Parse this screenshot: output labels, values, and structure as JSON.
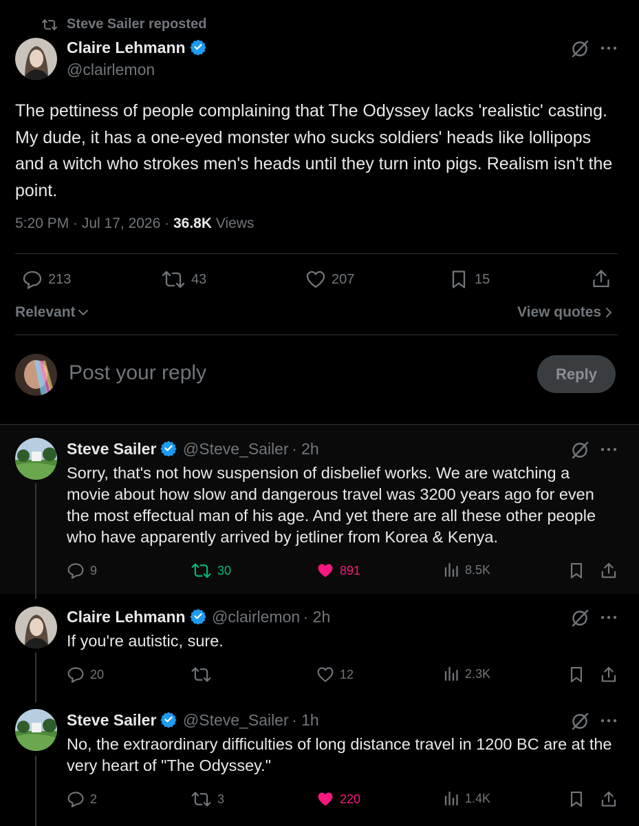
{
  "repost_banner": {
    "text": "Steve Sailer reposted"
  },
  "main_post": {
    "author_name": "Claire Lehmann",
    "author_handle": "@clairlemon",
    "text": "The pettiness of people complaining that The Odyssey lacks 'realistic' casting. My dude, it has a one-eyed monster who sucks soldiers' heads like lollipops and a witch who strokes men's heads until they turn into pigs. Realism isn't the point.",
    "time": "5:20 PM · Jul 17, 2026 · ",
    "views_count": "36.8K",
    "views_label": " Views",
    "stats": {
      "replies": "213",
      "reposts": "43",
      "likes": "207",
      "bookmarks": "15"
    }
  },
  "sort": {
    "label": "Relevant",
    "view_quotes": "View quotes"
  },
  "composer": {
    "placeholder": "Post your reply",
    "button": "Reply"
  },
  "replies": [
    {
      "author_name": "Steve Sailer",
      "author_handle": "@Steve_Sailer",
      "time": "· 2h",
      "text": "Sorry, that's not how suspension of disbelief works. We are watching a movie about how slow and dangerous travel was 3200 years ago for even the most effectual man of his age. And yet there are all these other people who have apparently arrived by jetliner from Korea & Kenya.",
      "replies": "9",
      "reposts": "30",
      "likes": "891",
      "views": "8.5K"
    },
    {
      "author_name": "Claire Lehmann",
      "author_handle": "@clairlemon",
      "time": "· 2h",
      "text": "If you're autistic, sure.",
      "replies": "20",
      "reposts": "",
      "likes": "12",
      "views": "2.3K"
    },
    {
      "author_name": "Steve Sailer",
      "author_handle": "@Steve_Sailer",
      "time": "· 1h",
      "text": "No, the extraordinary difficulties of long distance travel in 1200 BC are at the very heart of \"The Odyssey.\"",
      "replies": "2",
      "reposts": "3",
      "likes": "220",
      "views": "1.4K"
    }
  ],
  "colors": {
    "background": "#000000",
    "text": "#e7e9ea",
    "muted": "#71767b",
    "verified": "#1d9bf0",
    "like_active": "#f91880",
    "repost_active": "#00ba7c",
    "highlight_bg": "#0a0a0a"
  },
  "icons": [
    "repost-icon",
    "verified-badge-icon",
    "grok-icon",
    "more-icon",
    "reply-icon",
    "like-icon",
    "bookmark-icon",
    "share-icon",
    "views-icon",
    "chevron-down-icon",
    "chevron-right-icon"
  ]
}
